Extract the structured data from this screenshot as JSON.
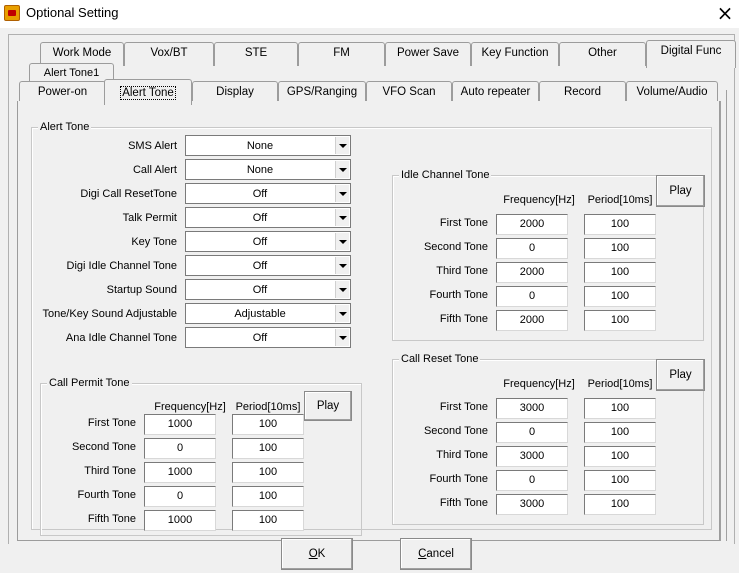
{
  "window": {
    "title": "Optional Setting"
  },
  "tabs_row1": [
    "Work Mode",
    "Vox/BT",
    "STE",
    "FM",
    "Power Save",
    "Key Function",
    "Other",
    "Digital Func"
  ],
  "tabs_row2": [
    "Alert Tone1"
  ],
  "tabs_row3": [
    "Power-on",
    "Alert Tone",
    "Display",
    "GPS/Ranging",
    "VFO Scan",
    "Auto repeater",
    "Record",
    "Volume/Audio"
  ],
  "active_tab": "Alert Tone",
  "alert_tone": {
    "title": "Alert Tone",
    "fields": [
      {
        "label": "SMS Alert",
        "value": "None"
      },
      {
        "label": "Call Alert",
        "value": "None"
      },
      {
        "label": "Digi Call ResetTone",
        "value": "Off"
      },
      {
        "label": "Talk Permit",
        "value": "Off"
      },
      {
        "label": "Key Tone",
        "value": "Off"
      },
      {
        "label": "Digi Idle Channel Tone",
        "value": "Off"
      },
      {
        "label": "Startup Sound",
        "value": "Off"
      },
      {
        "label": "Tone/Key Sound Adjustable",
        "value": "Adjustable"
      },
      {
        "label": "Ana Idle Channel Tone",
        "value": "Off"
      }
    ]
  },
  "call_permit_tone": {
    "title": "Call Permit Tone",
    "freq_header": "Frequency[Hz]",
    "period_header": "Period[10ms]",
    "play_label": "Play",
    "rows": [
      {
        "label": "First Tone",
        "freq": "1000",
        "period": "100"
      },
      {
        "label": "Second Tone",
        "freq": "0",
        "period": "100"
      },
      {
        "label": "Third Tone",
        "freq": "1000",
        "period": "100"
      },
      {
        "label": "Fourth Tone",
        "freq": "0",
        "period": "100"
      },
      {
        "label": "Fifth Tone",
        "freq": "1000",
        "period": "100"
      }
    ]
  },
  "idle_channel_tone": {
    "title": "Idle Channel Tone",
    "freq_header": "Frequency[Hz]",
    "period_header": "Period[10ms]",
    "play_label": "Play",
    "rows": [
      {
        "label": "First Tone",
        "freq": "2000",
        "period": "100"
      },
      {
        "label": "Second Tone",
        "freq": "0",
        "period": "100"
      },
      {
        "label": "Third Tone",
        "freq": "2000",
        "period": "100"
      },
      {
        "label": "Fourth Tone",
        "freq": "0",
        "period": "100"
      },
      {
        "label": "Fifth Tone",
        "freq": "2000",
        "period": "100"
      }
    ]
  },
  "call_reset_tone": {
    "title": "Call Reset Tone",
    "freq_header": "Frequency[Hz]",
    "period_header": "Period[10ms]",
    "play_label": "Play",
    "rows": [
      {
        "label": "First Tone",
        "freq": "3000",
        "period": "100"
      },
      {
        "label": "Second Tone",
        "freq": "0",
        "period": "100"
      },
      {
        "label": "Third Tone",
        "freq": "3000",
        "period": "100"
      },
      {
        "label": "Fourth Tone",
        "freq": "0",
        "period": "100"
      },
      {
        "label": "Fifth Tone",
        "freq": "3000",
        "period": "100"
      }
    ]
  },
  "buttons": {
    "ok_first": "O",
    "ok_rest": "K",
    "cancel_first": "C",
    "cancel_rest": "ancel"
  }
}
